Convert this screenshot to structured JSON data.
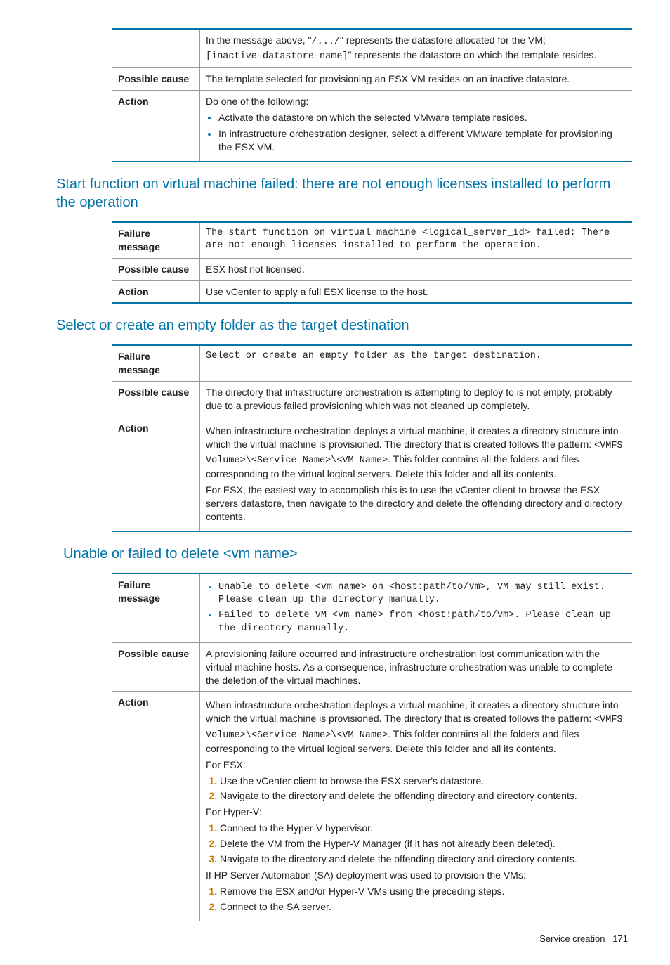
{
  "t1": {
    "r1_label": "",
    "r1_text1": "In the message above, \"",
    "r1_code1": "/.../",
    "r1_text2": "\" represents the datastore allocated for the VM;",
    "r1_code2": "[inactive-datastore-name]",
    "r1_text3": "\" represents the datastore on which the template resides.",
    "r2_label": "Possible cause",
    "r2_text": "The template selected for provisioning an ESX VM resides on an inactive datastore.",
    "r3_label": "Action",
    "r3_intro": "Do one of the following:",
    "r3_b1": "Activate the datastore on which the selected VMware template resides.",
    "r3_b2": "In infrastructure orchestration designer, select a different VMware template for provisioning the ESX VM."
  },
  "h1": "Start function on virtual machine failed: there are not enough licenses installed to perform the operation",
  "t2": {
    "r1_label": "Failure message",
    "r1_code": "The start function on virtual machine <logical_server_id> failed: There are not enough licenses installed to perform the operation.",
    "r2_label": "Possible cause",
    "r2_text": "ESX host not licensed.",
    "r3_label": "Action",
    "r3_text": "Use vCenter to apply a full ESX license to the host."
  },
  "h2": "Select or create an empty folder as the target destination",
  "t3": {
    "r1_label": "Failure message",
    "r1_code": "Select or create an empty folder as the target destination.",
    "r2_label": "Possible cause",
    "r2_text": "The directory that infrastructure orchestration is attempting to deploy to is not empty, probably due to a previous failed provisioning which was not cleaned up completely.",
    "r3_label": "Action",
    "r3_p1a": "When infrastructure orchestration deploys a virtual machine, it creates a directory structure into which the virtual machine is provisioned. The directory that is created follows the pattern: ",
    "r3_code": "<VMFS Volume>\\<Service Name>\\<VM Name>",
    "r3_p1b": ". This folder contains all the folders and files corresponding to the virtual logical servers. Delete this folder and all its contents.",
    "r3_p2": "For ESX, the easiest way to accomplish this is to use the vCenter client to browse the ESX servers datastore, then navigate to the directory and delete the offending directory and directory contents."
  },
  "h3": "Unable or failed to delete <vm name>",
  "t4": {
    "r1_label": "Failure message",
    "r1_b1": "Unable to delete <vm name> on <host:path/to/vm>, VM may still exist. Please clean up the directory manually.",
    "r1_b2": "Failed to delete VM <vm name> from <host:path/to/vm>. Please clean up the directory manually.",
    "r2_label": "Possible cause",
    "r2_text": "A provisioning failure occurred and infrastructure orchestration lost communication with the virtual machine hosts. As a consequence, infrastructure orchestration was unable to complete the deletion of the virtual machines.",
    "r3_label": "Action",
    "r3_p1a": "When infrastructure orchestration deploys a virtual machine, it creates a directory structure into which the virtual machine is provisioned. The directory that is created follows the pattern: ",
    "r3_code": "<VMFS Volume>\\<Service Name>\\<VM Name>",
    "r3_p1b": ". This folder contains all the folders and files corresponding to the virtual logical servers. Delete this folder and all its contents.",
    "r3_esx_h": "For ESX:",
    "r3_esx_1": "Use the vCenter client to browse the ESX server's datastore.",
    "r3_esx_2": "Navigate to the directory and delete the offending directory and directory contents.",
    "r3_hv_h": "For Hyper-V:",
    "r3_hv_1": "Connect to the Hyper-V hypervisor.",
    "r3_hv_2": "Delete the VM from the Hyper-V Manager (if it has not already been deleted).",
    "r3_hv_3": "Navigate to the directory and delete the offending directory and directory contents.",
    "r3_sa_h": "If HP Server Automation (SA) deployment was used to provision the VMs:",
    "r3_sa_1": "Remove the ESX and/or Hyper-V VMs using the preceding steps.",
    "r3_sa_2": "Connect to the SA server."
  },
  "footer_label": "Service creation",
  "footer_page": "171"
}
